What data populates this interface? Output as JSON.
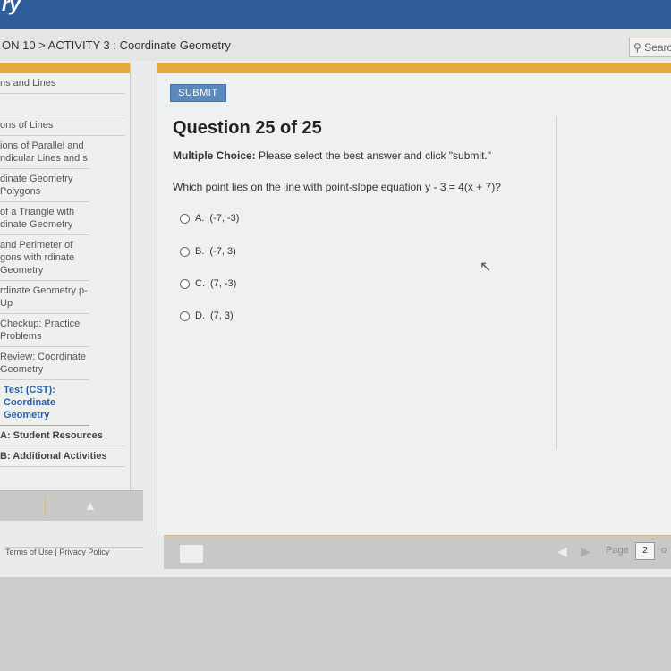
{
  "header": {
    "logo_text": "ry",
    "breadcrumb": "ON 10 > ACTIVITY 3 : Coordinate Geometry",
    "search_placeholder": "Searc"
  },
  "sidebar": {
    "items": [
      {
        "label": "ns and Lines"
      },
      {
        "label": ""
      },
      {
        "label": "ons of Lines"
      },
      {
        "label": "ions of Parallel and ndicular Lines and s"
      },
      {
        "label": "dinate Geometry Polygons"
      },
      {
        "label": "of a Triangle with dinate Geometry"
      },
      {
        "label": " and Perimeter of gons with rdinate Geometry"
      },
      {
        "label": "rdinate Geometry p-Up"
      },
      {
        "label": "Checkup: Practice Problems"
      },
      {
        "label": "Review: Coordinate Geometry"
      },
      {
        "label": "Test (CST): Coordinate Geometry",
        "active": true
      },
      {
        "label": "A: Student Resources"
      },
      {
        "label": "B: Additional Activities"
      }
    ]
  },
  "footer": {
    "terms": "Terms of Use",
    "sep": "|",
    "privacy": "Privacy Policy"
  },
  "question": {
    "submit_label": "SUBMIT",
    "title": "Question 25 of 25",
    "type_label": "Multiple Choice:",
    "instruction": "Please select the best answer and click \"submit.\"",
    "prompt": "Which point lies on the line with point-slope equation y - 3 = 4(x + 7)?",
    "options": [
      {
        "letter": "A.",
        "text": "(-7, -3)"
      },
      {
        "letter": "B.",
        "text": "(-7, 3)"
      },
      {
        "letter": "C.",
        "text": "(7, -3)"
      },
      {
        "letter": "D.",
        "text": "(7, 3)"
      }
    ]
  },
  "toolbar": {
    "page_label": "Page",
    "page_value": "2",
    "of_label": "o"
  },
  "colors": {
    "accent": "#e4a93c",
    "submit": "#5b88bd",
    "topbar": "#2f5d9c",
    "active_link": "#2c5fa8"
  }
}
